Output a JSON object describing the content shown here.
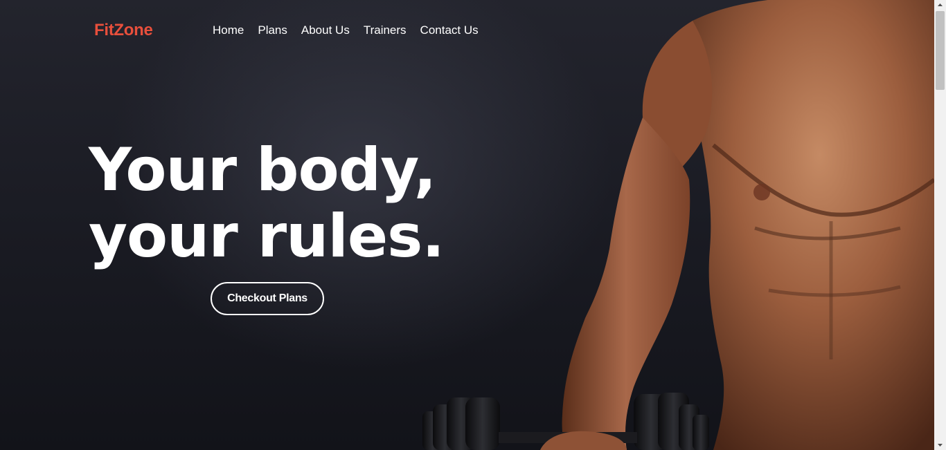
{
  "brand": {
    "name": "FitZone",
    "color": "#e84f3c"
  },
  "nav": {
    "items": [
      {
        "label": "Home"
      },
      {
        "label": "Plans"
      },
      {
        "label": "About Us"
      },
      {
        "label": "Trainers"
      },
      {
        "label": "Contact Us"
      }
    ]
  },
  "hero": {
    "headline_line1": "Your body,",
    "headline_line2": "your rules.",
    "cta_label": "Checkout Plans",
    "image": "muscular-man-holding-dumbbells"
  },
  "colors": {
    "background": "#1b1c24",
    "text": "#ffffff",
    "accent": "#e84f3c"
  }
}
